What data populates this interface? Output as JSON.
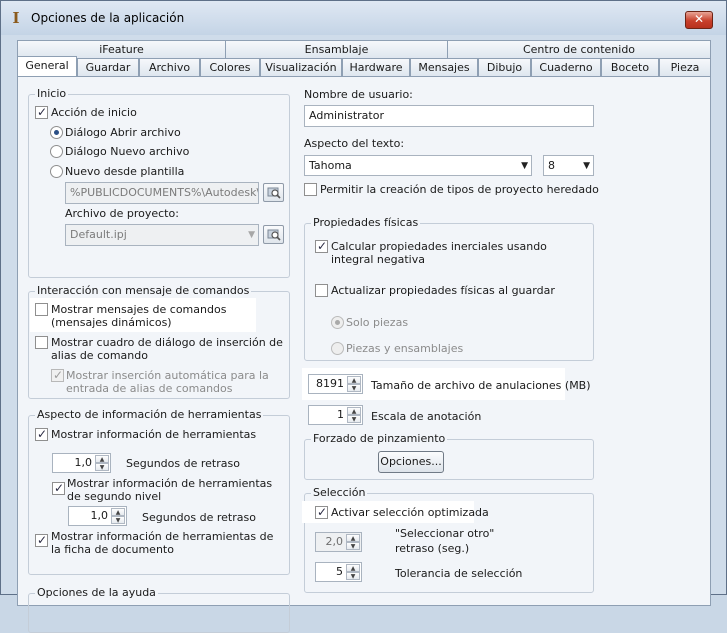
{
  "window": {
    "title": "Opciones de la aplicación",
    "close": "✕"
  },
  "tabs_top": [
    "iFeature",
    "Ensamblaje",
    "Centro de contenido"
  ],
  "tabs_bottom": [
    "General",
    "Guardar",
    "Archivo",
    "Colores",
    "Visualización",
    "Hardware",
    "Mensajes",
    "Dibujo",
    "Cuaderno",
    "Boceto",
    "Pieza"
  ],
  "startup": {
    "group": "Inicio",
    "action": "Acción de inicio",
    "open_dialog": "Diálogo Abrir archivo",
    "new_dialog": "Diálogo Nuevo archivo",
    "from_template": "Nuevo desde plantilla",
    "template_path": "%PUBLICDOCUMENTS%\\Autodesk\\Inv",
    "project_label": "Archivo de proyecto:",
    "project_value": "Default.ipj"
  },
  "command": {
    "group": "Interacción con mensaje de comandos",
    "show_prompts": "Mostrar mensajes de comandos (mensajes dinámicos)",
    "show_alias": "Mostrar cuadro de diálogo de inserción de alias de comando",
    "auto_insert": "Mostrar inserción automática para la entrada de alias de comandos"
  },
  "tooltip": {
    "group": "Aspecto de información de herramientas",
    "show": "Mostrar información de herramientas",
    "delay_value": "1,0",
    "delay_label": "Segundos de retraso",
    "show_second": "Mostrar información de herramientas de segundo nivel",
    "delay2_value": "1,0",
    "delay2_label": "Segundos de retraso",
    "show_doc": "Mostrar información de herramientas de la ficha de documento"
  },
  "help": {
    "group": "Opciones de la ayuda"
  },
  "user": {
    "label": "Nombre de usuario:",
    "value": "Administrator"
  },
  "text": {
    "label": "Aspecto del texto:",
    "font": "Tahoma",
    "size": "8",
    "legacy": "Permitir la creación de tipos de proyecto heredado"
  },
  "physical": {
    "group": "Propiedades físicas",
    "calc": "Calcular propiedades inerciales usando integral negativa",
    "update": "Actualizar propiedades físicas al guardar",
    "parts_only": "Solo piezas",
    "parts_assemblies": "Piezas y ensamblajes"
  },
  "undo": {
    "value": "8191",
    "label": "Tamaño de archivo de anulaciones (MB)"
  },
  "annotation": {
    "value": "1",
    "label": "Escala de anotación"
  },
  "pinning": {
    "group": "Forzado de pinzamiento",
    "button": "Opciones..."
  },
  "selection": {
    "group": "Selección",
    "optimized": "Activar selección optimizada",
    "delay_value": "2,0",
    "delay_label_1": "\"Seleccionar otro\"",
    "delay_label_2": "retraso (seg.)",
    "tolerance_value": "5",
    "tolerance_label": "Tolerancia de selección"
  }
}
